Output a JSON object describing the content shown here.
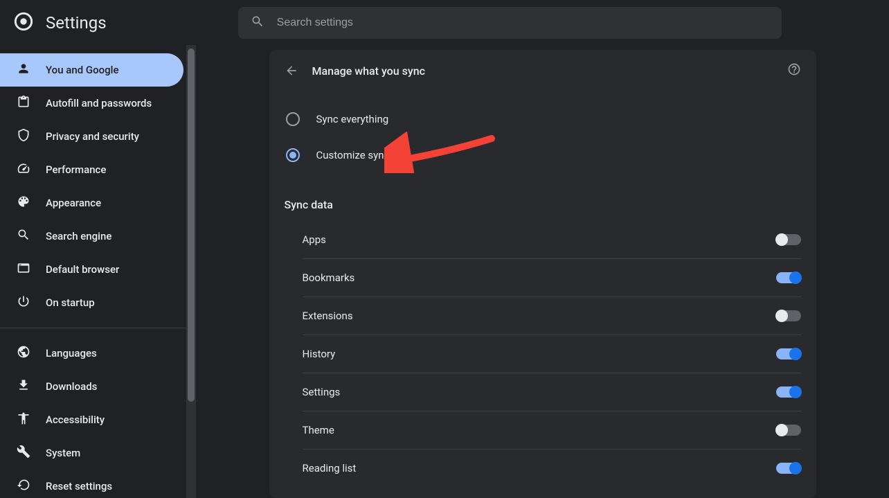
{
  "app_title": "Settings",
  "search": {
    "placeholder": "Search settings"
  },
  "sidebar": {
    "groups": [
      [
        {
          "id": "you-and-google",
          "label": "You and Google",
          "icon": "person",
          "active": true
        },
        {
          "id": "autofill",
          "label": "Autofill and passwords",
          "icon": "clipboard",
          "active": false
        },
        {
          "id": "privacy",
          "label": "Privacy and security",
          "icon": "shield",
          "active": false
        },
        {
          "id": "performance",
          "label": "Performance",
          "icon": "speed",
          "active": false
        },
        {
          "id": "appearance",
          "label": "Appearance",
          "icon": "palette",
          "active": false
        },
        {
          "id": "search-engine",
          "label": "Search engine",
          "icon": "search",
          "active": false
        },
        {
          "id": "default-browser",
          "label": "Default browser",
          "icon": "browser",
          "active": false
        },
        {
          "id": "on-startup",
          "label": "On startup",
          "icon": "power",
          "active": false
        }
      ],
      [
        {
          "id": "languages",
          "label": "Languages",
          "icon": "globe",
          "active": false
        },
        {
          "id": "downloads",
          "label": "Downloads",
          "icon": "download",
          "active": false
        },
        {
          "id": "accessibility",
          "label": "Accessibility",
          "icon": "accessibility",
          "active": false
        },
        {
          "id": "system",
          "label": "System",
          "icon": "wrench",
          "active": false
        },
        {
          "id": "reset",
          "label": "Reset settings",
          "icon": "reset",
          "active": false
        }
      ]
    ]
  },
  "panel": {
    "title": "Manage what you sync",
    "radios": [
      {
        "id": "sync-everything",
        "label": "Sync everything",
        "checked": false
      },
      {
        "id": "customize-sync",
        "label": "Customize sync",
        "checked": true
      }
    ],
    "section_title": "Sync data",
    "toggles": [
      {
        "id": "apps",
        "label": "Apps",
        "on": false
      },
      {
        "id": "bookmarks",
        "label": "Bookmarks",
        "on": true
      },
      {
        "id": "extensions",
        "label": "Extensions",
        "on": false
      },
      {
        "id": "history",
        "label": "History",
        "on": true
      },
      {
        "id": "settings",
        "label": "Settings",
        "on": true
      },
      {
        "id": "theme",
        "label": "Theme",
        "on": false
      },
      {
        "id": "reading-list",
        "label": "Reading list",
        "on": true
      }
    ]
  },
  "annotation": {
    "arrow_color": "#f44336"
  }
}
